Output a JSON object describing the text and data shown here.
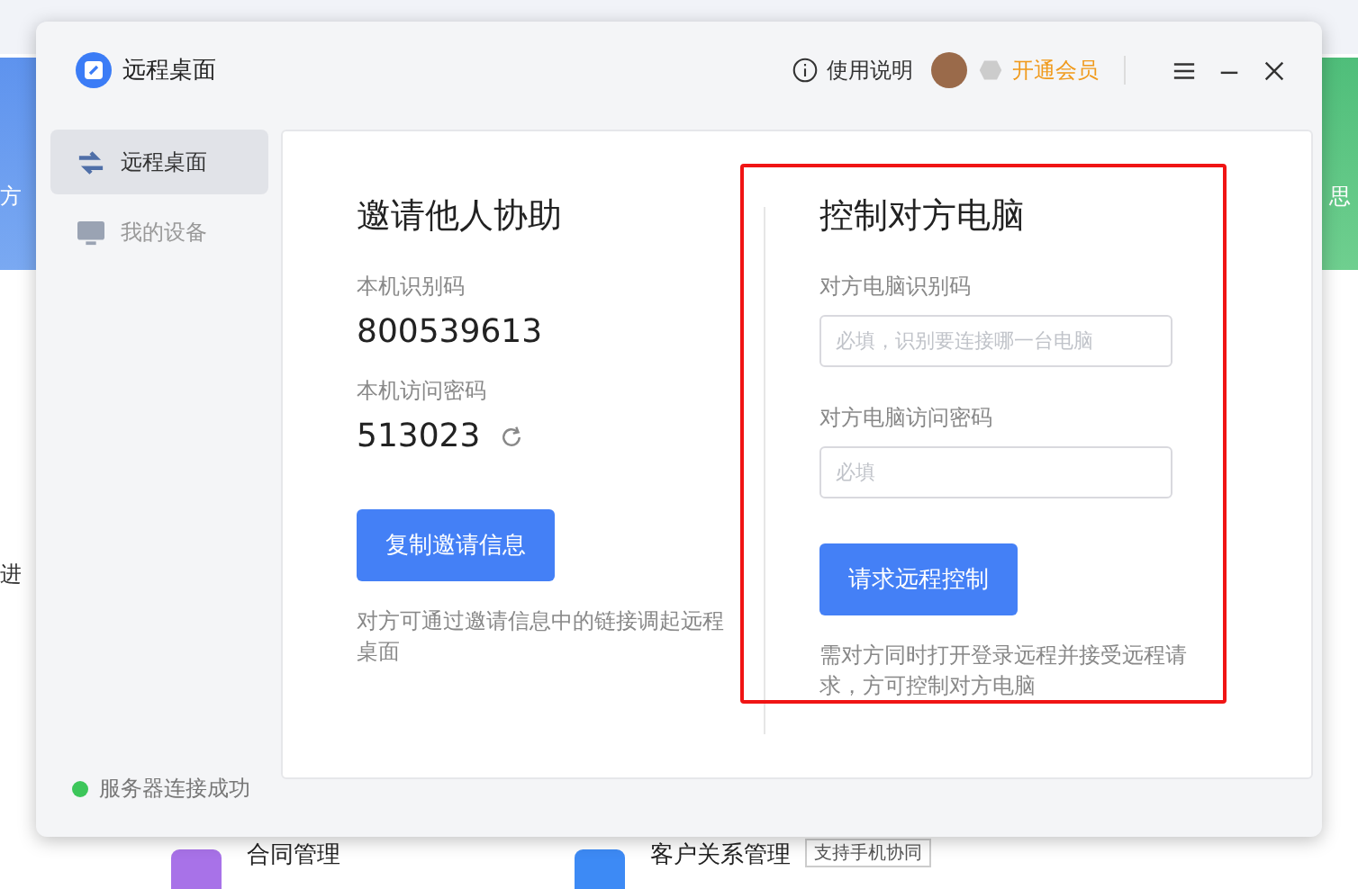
{
  "background": {
    "texts": [
      {
        "kind": "left",
        "text": "方"
      },
      {
        "kind": "left2",
        "text": "进"
      },
      {
        "kind": "right",
        "text": "思"
      }
    ],
    "items": [
      {
        "title": "合同管理",
        "color": "#a872e8"
      },
      {
        "title": "客户关系管理",
        "color": "#3d8af5",
        "tag": "支持手机协同"
      }
    ]
  },
  "window": {
    "title": "远程桌面",
    "help": "使用说明",
    "vip": "开通会员"
  },
  "sidebar": {
    "items": [
      {
        "label": "远程桌面",
        "selected": true
      },
      {
        "label": "我的设备",
        "selected": false
      }
    ],
    "status": {
      "text": "服务器连接成功",
      "connected": true
    }
  },
  "invite": {
    "heading": "邀请他人协助",
    "id_label": "本机识别码",
    "id": "800539613",
    "pw_label": "本机访问密码",
    "pw": "513023",
    "button": "复制邀请信息",
    "note": "对方可通过邀请信息中的链接调起远程桌面"
  },
  "control": {
    "heading": "控制对方电脑",
    "id_label": "对方电脑识别码",
    "id_placeholder": "必填，识别要连接哪一台电脑",
    "pw_label": "对方电脑访问密码",
    "pw_placeholder": "必填",
    "button": "请求远程控制",
    "note": "需对方同时打开登录远程并接受远程请求，方可控制对方电脑",
    "highlighted": true
  }
}
